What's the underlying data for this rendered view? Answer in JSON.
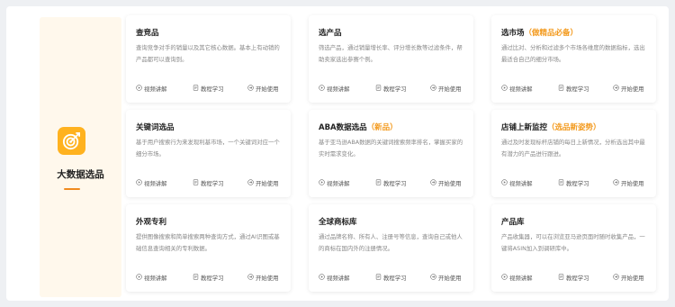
{
  "sidebar": {
    "title": "大数据选品",
    "icon": "target-icon"
  },
  "actions": {
    "video": "视频讲解",
    "tutorial": "教程学习",
    "start": "开始使用"
  },
  "cards": [
    {
      "title": "查竞品",
      "highlight": "",
      "desc": "查询竞争对手的销量以及其它核心数据。基本上有动销的产品都可以查询到。"
    },
    {
      "title": "选产品",
      "highlight": "",
      "desc": "筛选产品，通过销量增长率、评分增长数等过滤条件，帮助卖家选出参赛个例。"
    },
    {
      "title": "选市场",
      "highlight": "（做精品必备）",
      "desc": "通过比对、分析和过滤多个市场各维度的数据指标，选出最适合自己的细分市场。"
    },
    {
      "title": "关键词选品",
      "highlight": "",
      "desc": "基于用户搜索行为来发现利基市场，一个关键词对应一个细分市场。"
    },
    {
      "title": "ABA数据选品",
      "highlight": "（新品）",
      "desc": "基于亚马逊ABA数据的关键词搜索频率排名，掌握买家的实时需求变化。"
    },
    {
      "title": "店铺上新监控",
      "highlight": "（选品新姿势）",
      "desc": "通过及时发现标杆店铺的每日上新情况，分析选出其中最有潜力的产品进行跟进。"
    },
    {
      "title": "外观专利",
      "highlight": "",
      "desc": "提供图像搜索和简单搜索两种查询方式，通过AI识图或基础信息查询相关的专利数据。"
    },
    {
      "title": "全球商标库",
      "highlight": "",
      "desc": "通过品牌名称、所有人、注册号等信息，查询自己或他人的商标在国内外的注册情况。"
    },
    {
      "title": "产品库",
      "highlight": "",
      "desc": "产品收集器，可以在浏览亚马逊页面时随时收集产品，一键将ASIN加入到调研库中。"
    }
  ],
  "colors": {
    "accent": "#f39a1e",
    "icon_bg": "#ffb21f",
    "sidebar_bg": "#fff8ec"
  }
}
